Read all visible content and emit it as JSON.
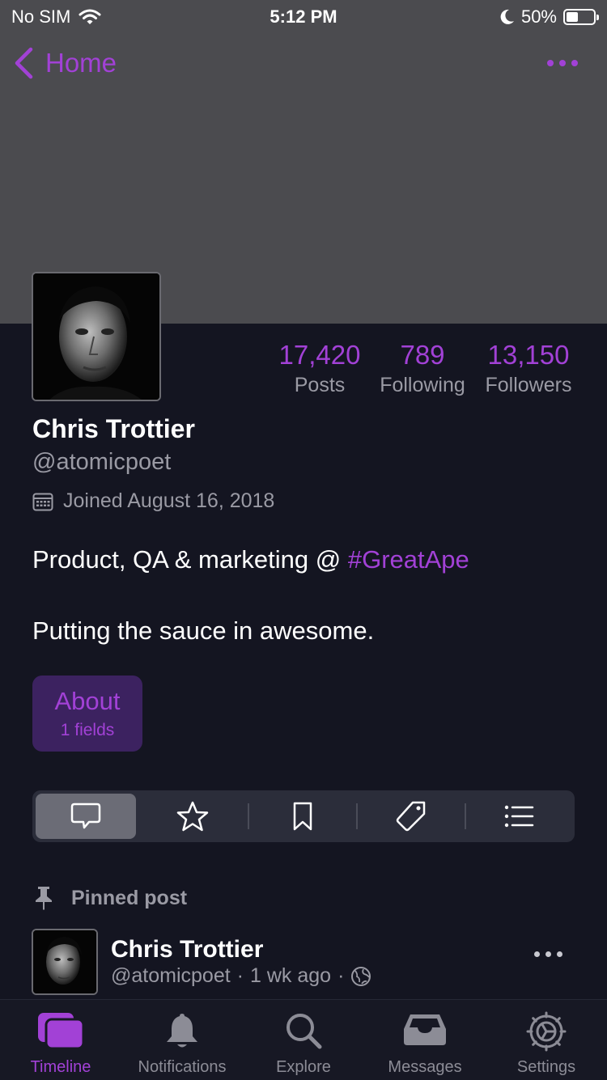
{
  "status_bar": {
    "carrier": "No SIM",
    "time": "5:12 PM",
    "battery_percent": "50%",
    "battery_level": 0.5
  },
  "nav": {
    "back_label": "Home"
  },
  "profile": {
    "stats": [
      {
        "value": "17,420",
        "label": "Posts"
      },
      {
        "value": "789",
        "label": "Following"
      },
      {
        "value": "13,150",
        "label": "Followers"
      }
    ],
    "display_name": "Chris Trottier",
    "handle": "@atomicpoet",
    "joined": "Joined August 16, 2018",
    "bio_line1_prefix": "Product, QA & marketing @ ",
    "bio_line1_hashtag": "#GreatApe",
    "bio_line2": "Putting the sauce in awesome.",
    "about": {
      "title": "About",
      "subtitle": "1 fields"
    }
  },
  "segments": [
    "posts-icon",
    "star-icon",
    "bookmark-icon",
    "tag-icon",
    "list-icon"
  ],
  "pinned_post": {
    "header": "Pinned post",
    "author_name": "Chris Trottier",
    "author_handle": "@atomicpoet",
    "separator": "·",
    "time_ago": "1 wk ago"
  },
  "tabbar": [
    {
      "label": "Timeline",
      "icon": "timeline-icon",
      "active": true
    },
    {
      "label": "Notifications",
      "icon": "bell-icon",
      "active": false
    },
    {
      "label": "Explore",
      "icon": "search-icon",
      "active": false
    },
    {
      "label": "Messages",
      "icon": "inbox-icon",
      "active": false
    },
    {
      "label": "Settings",
      "icon": "gear-icon",
      "active": false
    }
  ],
  "colors": {
    "accent": "#a241d6",
    "background": "#141521",
    "banner": "#4b4b4f",
    "secondary_text": "#9a9aa4"
  }
}
